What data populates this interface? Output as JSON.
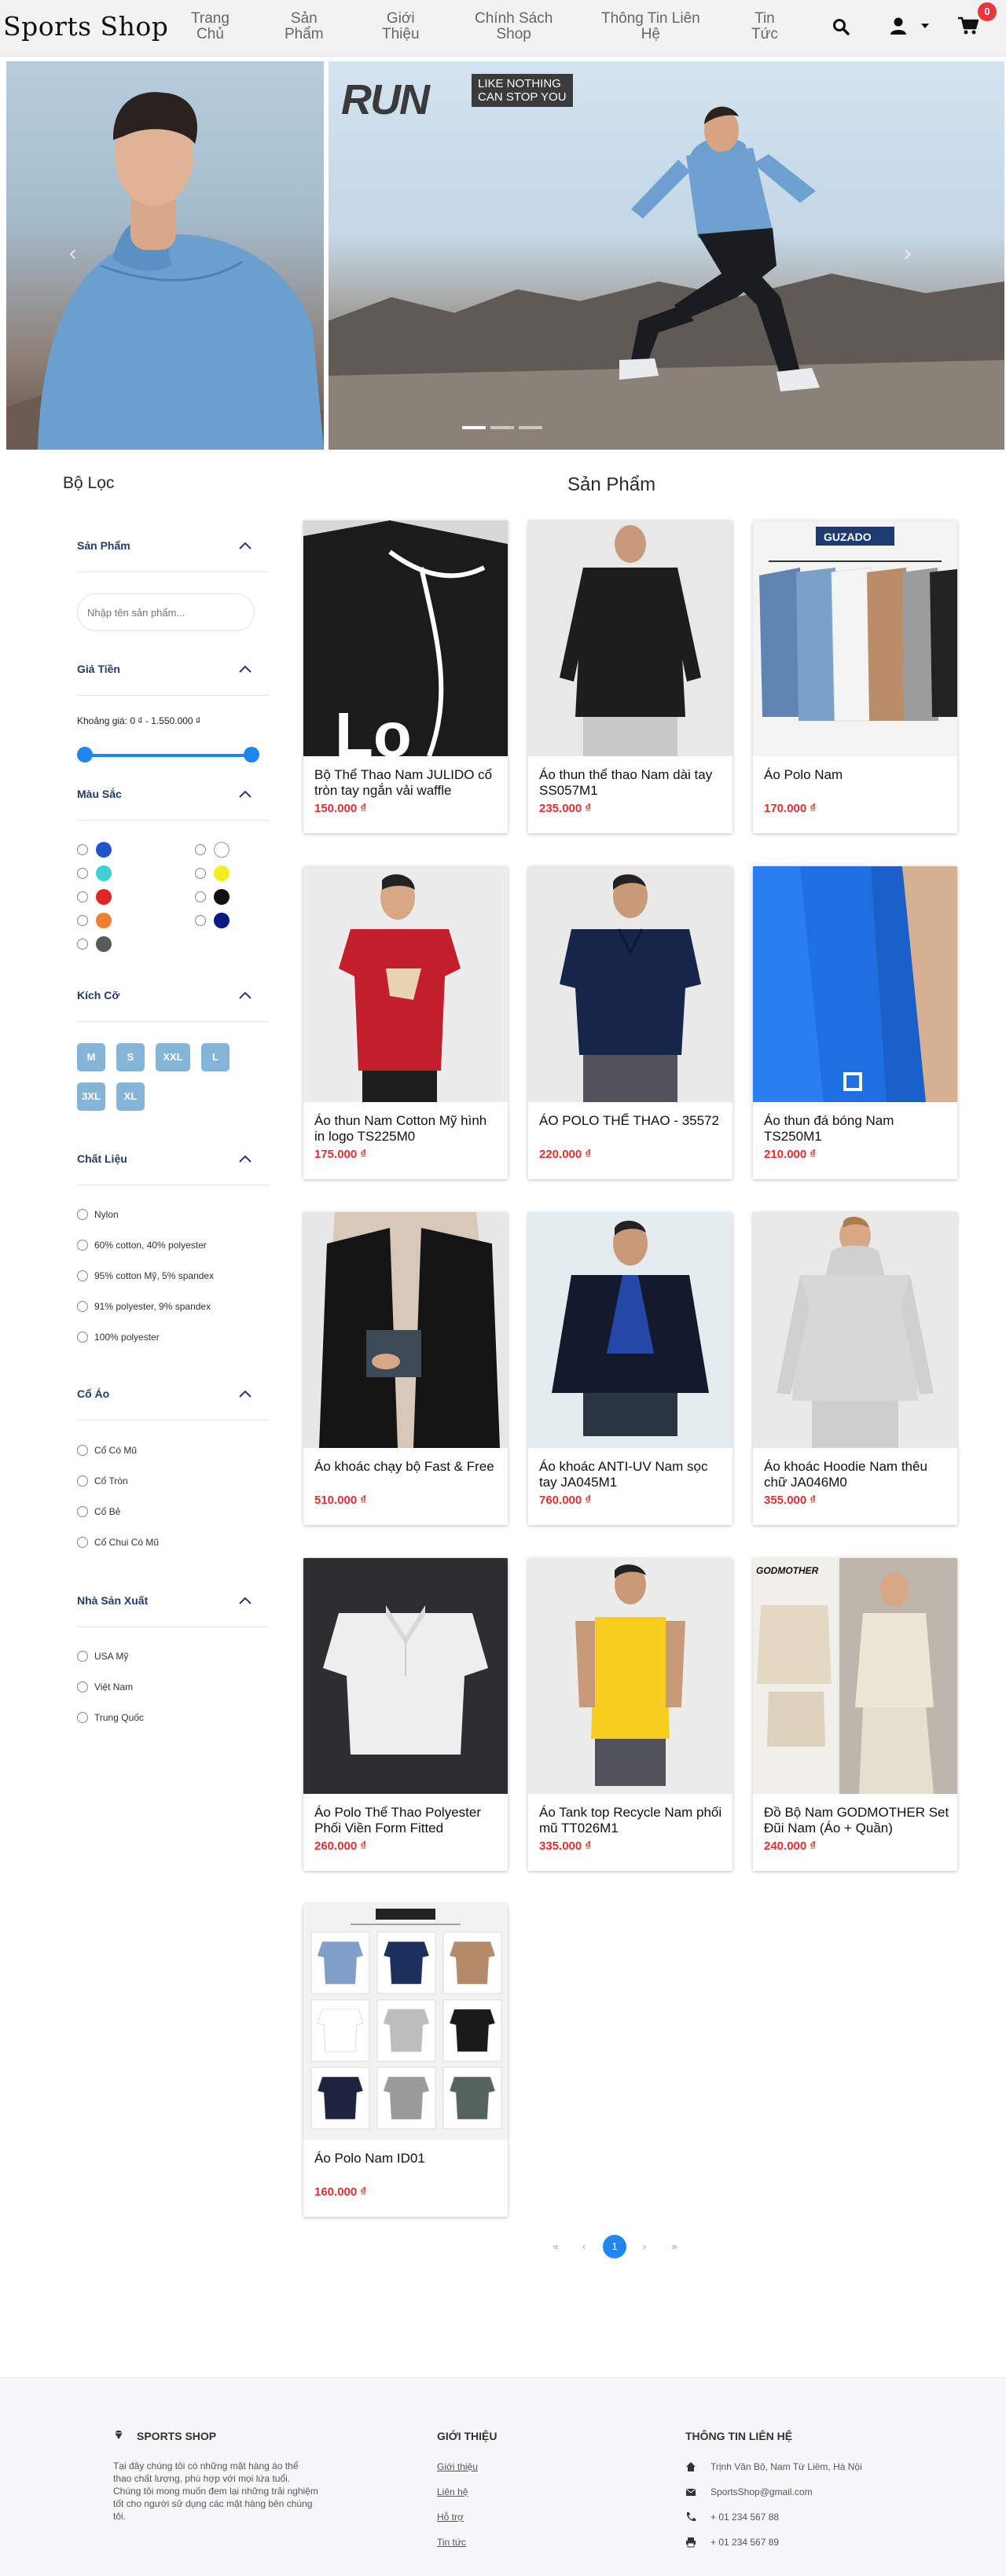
{
  "header": {
    "logo": "Sports Shop",
    "nav": [
      {
        "line1": "Trang",
        "line2": "Chủ"
      },
      {
        "line1": "Sản",
        "line2": "Phẩm"
      },
      {
        "line1": "Giới",
        "line2": "Thiệu"
      },
      {
        "line1": "Chính Sách",
        "line2": "Shop"
      },
      {
        "line1": "Thông Tin Liên",
        "line2": "Hệ"
      },
      {
        "line1": "Tin",
        "line2": "Tức"
      }
    ],
    "icons": [
      "search-icon",
      "user-icon",
      "chevron-down-icon",
      "cart-icon"
    ],
    "cart_count": "0"
  },
  "banner": {
    "brand_text": "RUN",
    "tagline_1": "LIKE NOTHING",
    "tagline_2": "CAN STOP YOU",
    "prev": "‹",
    "next": "›",
    "slide_count": 3,
    "active_slide": 0
  },
  "filters": {
    "title": "Bộ Lọc",
    "product_section": "Sản Phẩm",
    "search_placeholder": "Nhập tên sản phẩm...",
    "price_section": "Giá Tiền",
    "price_label": "Khoảng giá: 0 ₫ - 1.550.000 ₫",
    "price_min_fraction": 0,
    "price_max_fraction": 1,
    "color_section": "Màu Sắc",
    "colors": [
      "#2255cc",
      "#ffffff",
      "#3ed0d2",
      "#f2ee22",
      "#e02525",
      "#111111",
      "#f08030",
      "#0c1a80",
      "#5a5a5a"
    ],
    "size_section": "Kích Cỡ",
    "sizes": [
      "M",
      "S",
      "XXL",
      "L",
      "3XL",
      "XL"
    ],
    "material_section": "Chất Liệu",
    "materials": [
      "Nylon",
      "60% cotton, 40% polyester",
      "95% cotton Mỹ, 5% spandex",
      "91% polyester, 9% spandex",
      "100% polyester"
    ],
    "collar_section": "Cổ Áo",
    "collars": [
      "Cổ Có Mũ",
      "Cổ Tròn",
      "Cổ Bẻ",
      "Cổ Chui Có Mũ"
    ],
    "maker_section": "Nhà Sản Xuất",
    "makers": [
      "USA Mỹ",
      "Việt Nam",
      "Trung Quốc"
    ]
  },
  "products_title": "Sản Phẩm",
  "products": [
    {
      "name": "Bộ Thể Thao Nam JULIDO cổ tròn tay ngắn vải waffle",
      "price": "150.000 ₫",
      "bg": "#1b1b1b"
    },
    {
      "name": "Áo thun thể thao Nam dài tay SS057M1",
      "price": "235.000 ₫",
      "bg": "#e8e8e8"
    },
    {
      "name": "Áo Polo Nam",
      "price": "170.000 ₫",
      "bg": "#f0f0f0"
    },
    {
      "name": "Áo thun Nam Cotton Mỹ hình in logo TS225M0",
      "price": "175.000 ₫",
      "bg": "#ececec"
    },
    {
      "name": "ÁO POLO THỂ THAO - 35572",
      "price": "220.000 ₫",
      "bg": "#e9e9e9"
    },
    {
      "name": "Áo thun đá bóng Nam TS250M1",
      "price": "210.000 ₫",
      "bg": "#1f6fe0"
    },
    {
      "name": "Áo khoác chạy bộ Fast & Free",
      "price": "510.000 ₫",
      "bg": "#e7e7e7"
    },
    {
      "name": "Áo khoác ANTI-UV Nam sọc tay JA045M1",
      "price": "760.000 ₫",
      "bg": "#e4ecef"
    },
    {
      "name": "Áo khoác Hoodie Nam thêu chữ JA046M0",
      "price": "355.000 ₫",
      "bg": "#e9e9e9"
    },
    {
      "name": "Áo Polo Thể Thao Polyester Phối Viền Form Fitted",
      "price": "260.000 ₫",
      "bg": "#2d2e30"
    },
    {
      "name": "Áo Tank top Recycle Nam phối mũ TT026M1",
      "price": "335.000 ₫",
      "bg": "#ececec"
    },
    {
      "name": "Đồ Bộ Nam GODMOTHER Set Đũi Nam (Áo + Quần)",
      "price": "240.000 ₫",
      "bg": "#ece8e2"
    },
    {
      "name": "Áo Polo Nam ID01",
      "price": "160.000 ₫",
      "bg": "#f2f2f2"
    }
  ],
  "product_image_text": {
    "guzado": "GUZADO",
    "godmother": "GODMOTHER"
  },
  "pagination": {
    "first": "«",
    "prev": "‹",
    "current": "1",
    "next": "›",
    "last": "»"
  },
  "footer": {
    "brand": "SPORTS SHOP",
    "about_text": "Tại đây chúng tôi có những mặt hàng áo thể thao chất lượng, phù hợp với mọi lứa tuổi. Chúng tôi mong muốn đem lại những trải nghiệm tốt cho người sử dụng các mặt hàng bên chúng tôi.",
    "intro_head": "GIỚI THIỆU",
    "links": [
      "Giới thiệu",
      "Liên hệ",
      "Hỗ trợ",
      "Tin tức"
    ],
    "contact_head": "THÔNG TIN LIÊN HỆ",
    "contacts": [
      {
        "icon": "home-icon",
        "text": "Trịnh Văn Bô, Nam Từ Liêm, Hà Nội"
      },
      {
        "icon": "email-icon",
        "text": "SportsShop@gmail.com"
      },
      {
        "icon": "phone-icon",
        "text": "+ 01 234 567 88"
      },
      {
        "icon": "printer-icon",
        "text": "+ 01 234 567 89"
      }
    ]
  }
}
